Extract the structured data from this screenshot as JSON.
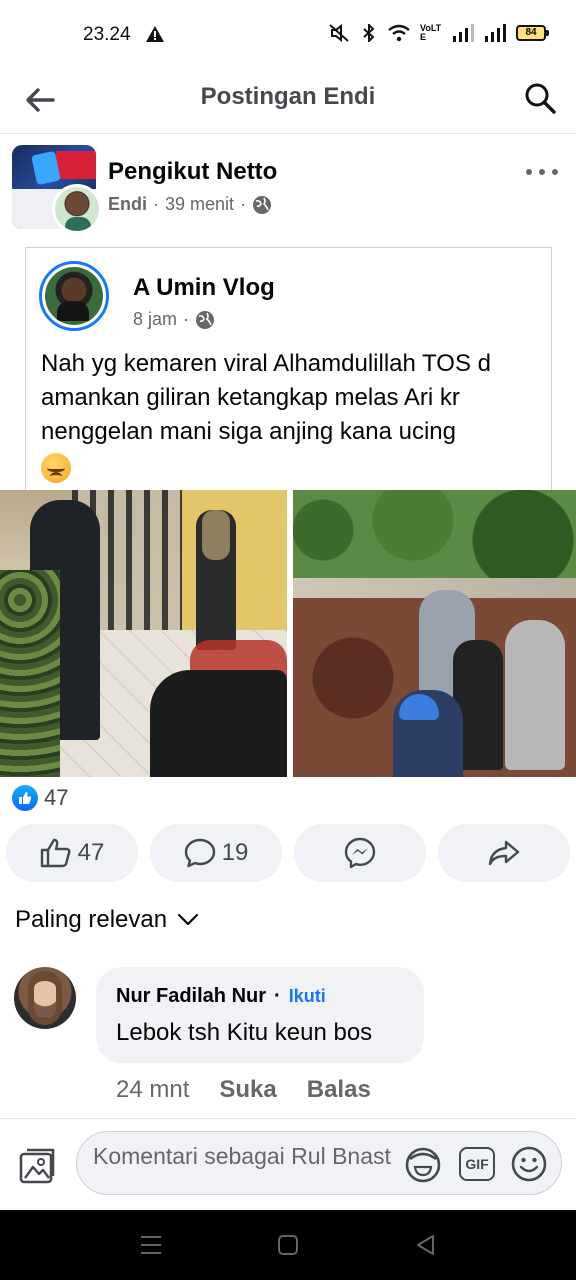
{
  "status_bar": {
    "time": "23.24",
    "battery": "84",
    "network": "VoLTE"
  },
  "header": {
    "title": "Postingan Endi"
  },
  "post": {
    "title": "Pengikut Netto",
    "author": "Endi",
    "time": "39 menit",
    "separator": "·"
  },
  "shared_post": {
    "author": "A Umin Vlog",
    "time": "8 jam",
    "text": "Nah yg kemaren viral Alhamdulillah TOS d amankan giliran ketangkap melas Ari kr nenggelan mani siga anjing kana ucing"
  },
  "reactions": {
    "count": "47"
  },
  "actions": {
    "like_count": "47",
    "comment_count": "19"
  },
  "sort": {
    "label": "Paling relevan"
  },
  "comment": {
    "author": "Nur Fadilah Nur",
    "follow": "Ikuti",
    "dot": "·",
    "text": "Lebok tsh Kitu keun bos",
    "time": "24 mnt",
    "like": "Suka",
    "reply": "Balas"
  },
  "composer": {
    "placeholder": "Komentari sebagai Rul Bnast",
    "gif": "GIF"
  }
}
